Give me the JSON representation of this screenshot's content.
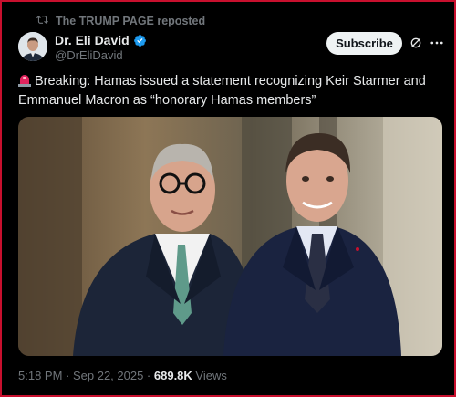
{
  "repost": {
    "icon": "repost-icon",
    "text": "The TRUMP PAGE reposted"
  },
  "author": {
    "name": "Dr. Eli David",
    "handle": "@DrEliDavid",
    "verified_color": "#1d9bf0",
    "avatar_icon": "avatar"
  },
  "actions": {
    "subscribe_label": "Subscribe",
    "grok_icon": "grok-icon",
    "more_icon": "more-icon"
  },
  "post": {
    "emoji_icon": "siren-icon",
    "text": "Breaking: Hamas issued a statement recognizing Keir Starmer and Emmanuel Macron as “honorary Hamas members”"
  },
  "media": {
    "type": "photo"
  },
  "meta": {
    "time_date": "5:18 PM · Sep 22, 2025 · ",
    "views_count": "689.8K",
    "views_label": " Views"
  },
  "colors": {
    "background": "#000000",
    "text": "#e7e9ea",
    "muted": "#71767b",
    "frame": "#c8102e",
    "accent": "#1d9bf0"
  }
}
